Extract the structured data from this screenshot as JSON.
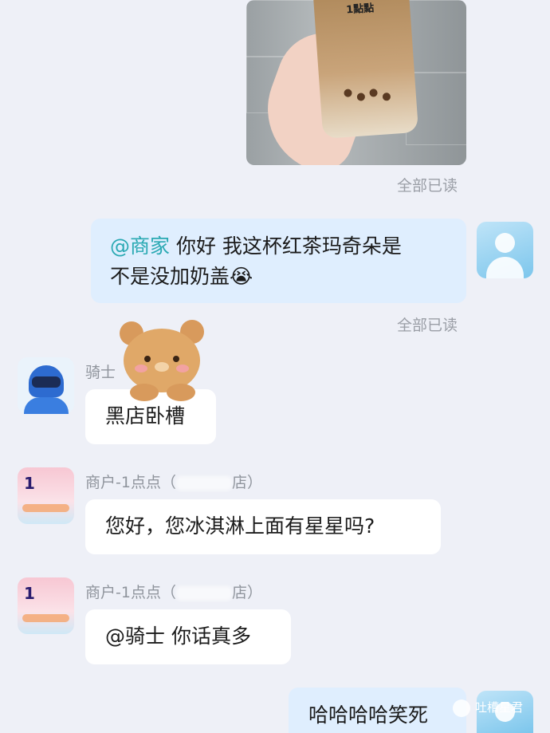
{
  "messages": {
    "image_read": "全部已读",
    "msg1": {
      "mention": "@商家",
      "text_line1": " 你好 我这杯红茶玛奇朵是",
      "text_line2": "不是没加奶盖",
      "emoji": "😭",
      "read": "全部已读"
    },
    "msg2": {
      "sender": "骑士",
      "text": "黑店卧槽"
    },
    "msg3": {
      "sender": "商户-1点点（",
      "sender_tail": "店）",
      "text": "您好，您冰淇淋上面有星星吗?"
    },
    "msg4": {
      "sender": "商户-1点点（",
      "sender_tail": "店）",
      "text": "@骑士 你话真多"
    },
    "msg5": {
      "text": "哈哈哈哈笑死"
    }
  },
  "cup_print": "1點點",
  "watermark": "吐槽星君",
  "colors": {
    "background": "#eef0f7",
    "right_bubble": "#dfeefe",
    "mention": "#2aa9b3"
  }
}
